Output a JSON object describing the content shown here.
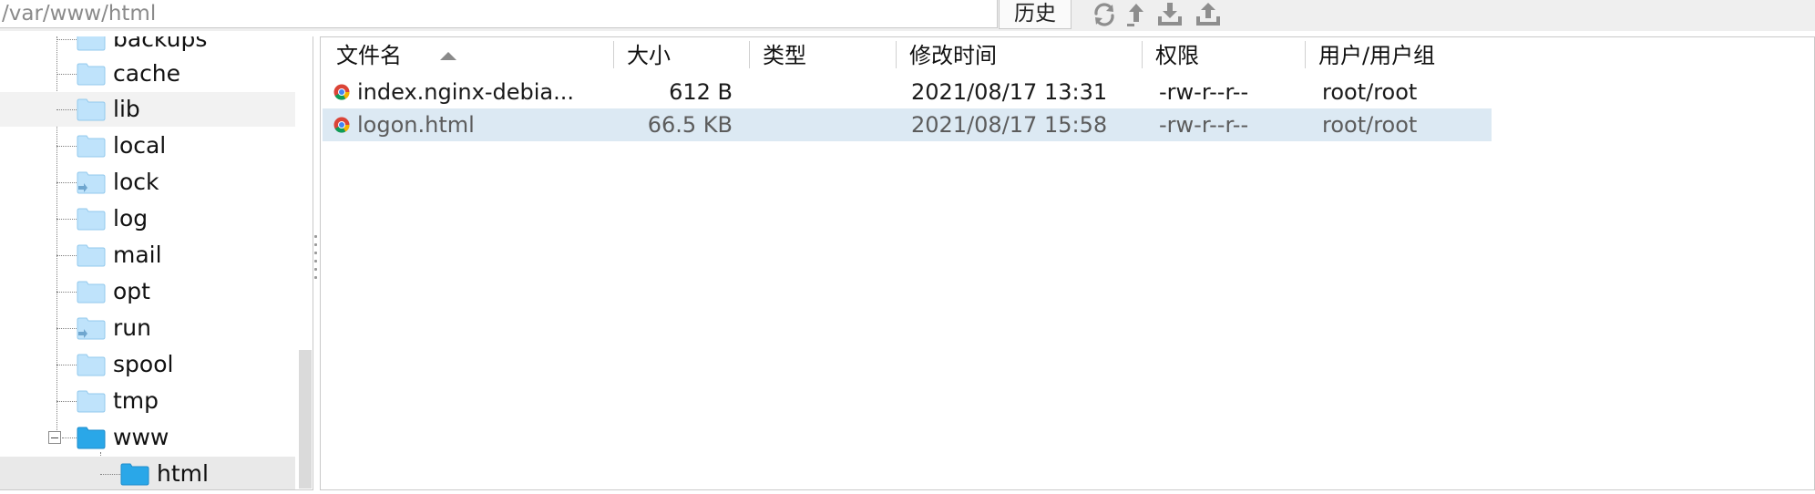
{
  "path_bar": {
    "value": "/var/www/html"
  },
  "toolbar": {
    "history_label": "历史",
    "icons": [
      "refresh-icon",
      "up-directory-icon",
      "download-icon",
      "upload-icon"
    ]
  },
  "tree": {
    "items": [
      {
        "label": "backups",
        "state": "partially-visible"
      },
      {
        "label": "cache"
      },
      {
        "label": "lib",
        "state": "hover"
      },
      {
        "label": "local"
      },
      {
        "label": "lock",
        "icon": "link-folder"
      },
      {
        "label": "log"
      },
      {
        "label": "mail"
      },
      {
        "label": "opt"
      },
      {
        "label": "run",
        "icon": "link-folder"
      },
      {
        "label": "spool"
      },
      {
        "label": "tmp"
      },
      {
        "label": "www",
        "expanded": true
      },
      {
        "label": "html",
        "state": "selected",
        "level": 2
      }
    ]
  },
  "file_list": {
    "columns": [
      "文件名",
      "大小",
      "类型",
      "修改时间",
      "权限",
      "用户/用户组"
    ],
    "sort": {
      "column": "文件名",
      "direction": "ascending"
    },
    "rows": [
      {
        "name": "index.nginx-debia...",
        "size": "612 B",
        "type": "",
        "modified": "2021/08/17 13:31",
        "perms": "-rw-r--r--",
        "owner": "root/root"
      },
      {
        "name": "logon.html",
        "size": "66.5 KB",
        "type": "",
        "modified": "2021/08/17 15:58",
        "perms": "-rw-r--r--",
        "owner": "root/root",
        "selected": true
      }
    ]
  },
  "colors": {
    "folder": "#bfe3fb",
    "folder_selected": "#2aa7e8",
    "selection": "#dce9f3",
    "tree_selection": "#e9e9e9"
  }
}
